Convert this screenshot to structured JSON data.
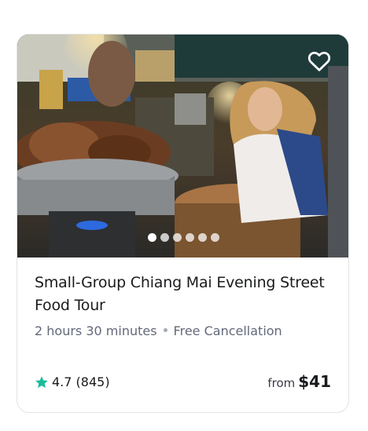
{
  "tour": {
    "title": "Small-Group Chiang Mai Evening Street Food Tour",
    "duration": "2 hours 30 minutes",
    "cancellation": "Free Cancellation",
    "rating": "4.7",
    "reviews": "(845)",
    "price_prefix": "from",
    "price": "$41",
    "favorite_icon": "heart-outline-icon",
    "rating_icon": "star-icon",
    "carousel": {
      "count": 6,
      "active_index": 0
    }
  },
  "colors": {
    "star": "#1bbc9b",
    "title": "#1a1b1d",
    "meta": "#63687a"
  }
}
